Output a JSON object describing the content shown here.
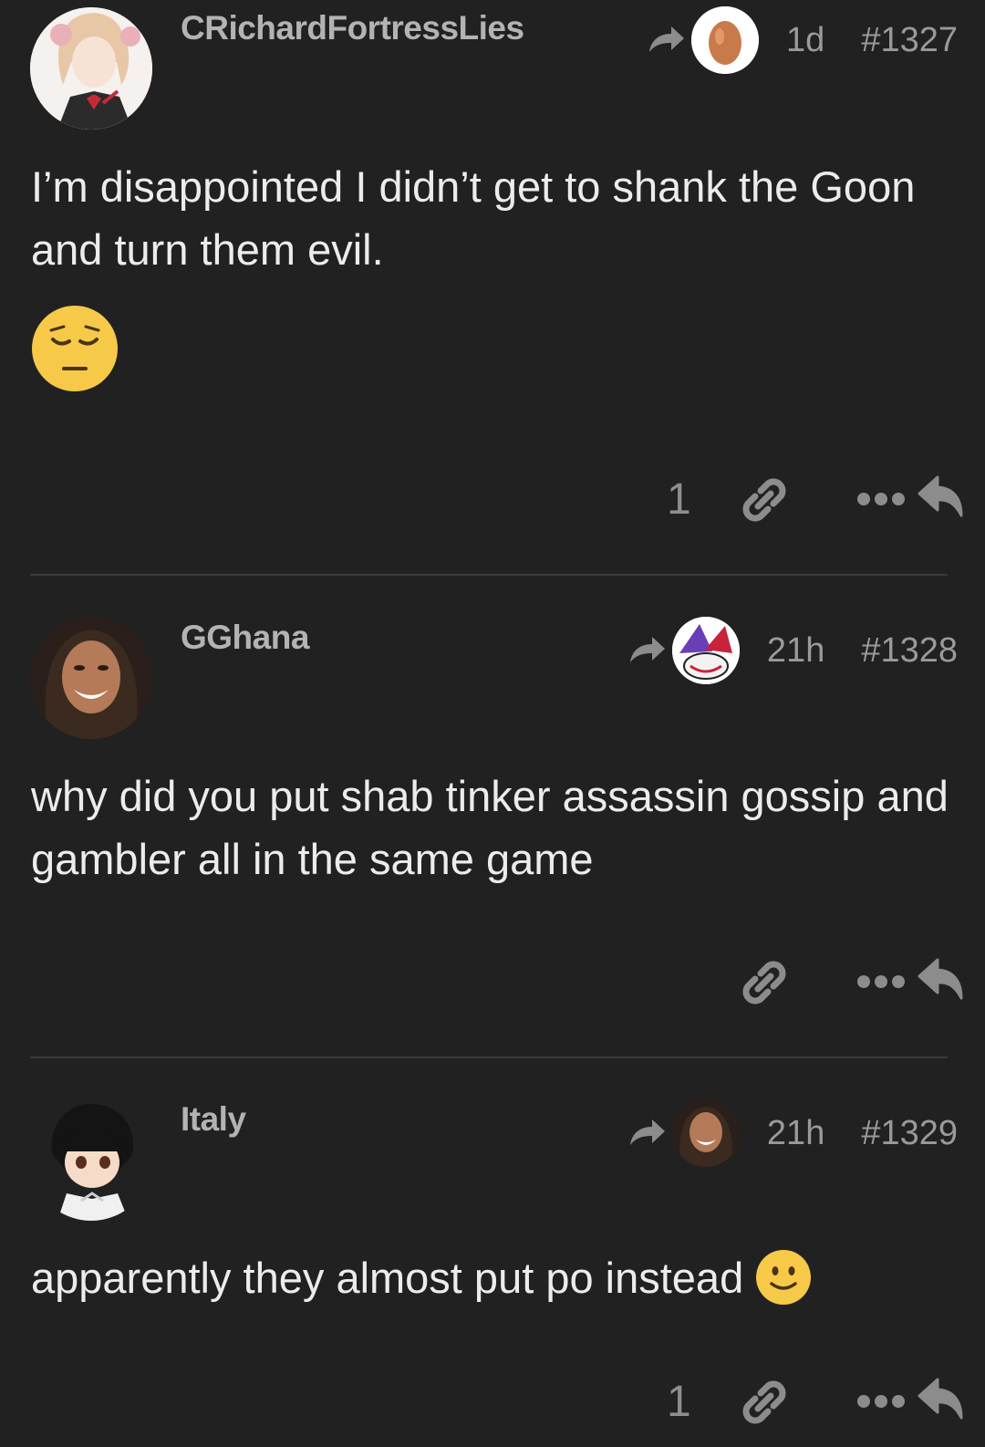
{
  "posts": [
    {
      "username": "CRichardFortressLies",
      "time": "1d",
      "number": "#1327",
      "text": "I’m disappointed I didn’t get to shank the Goon and turn them evil.",
      "likes": "1"
    },
    {
      "username": "GGhana",
      "time": "21h",
      "number": "#1328",
      "text": "why did you put shab tinker assassin gossip and gambler all in the same game",
      "likes": ""
    },
    {
      "username": "Italy",
      "time": "21h",
      "number": "#1329",
      "text": "apparently they almost put po instead",
      "likes": "1"
    }
  ],
  "colors": {
    "background": "#212121",
    "text": "#ececec",
    "meta": "#9a9a9a",
    "divider": "#3b3b3b",
    "emoji": "#f7c948"
  }
}
